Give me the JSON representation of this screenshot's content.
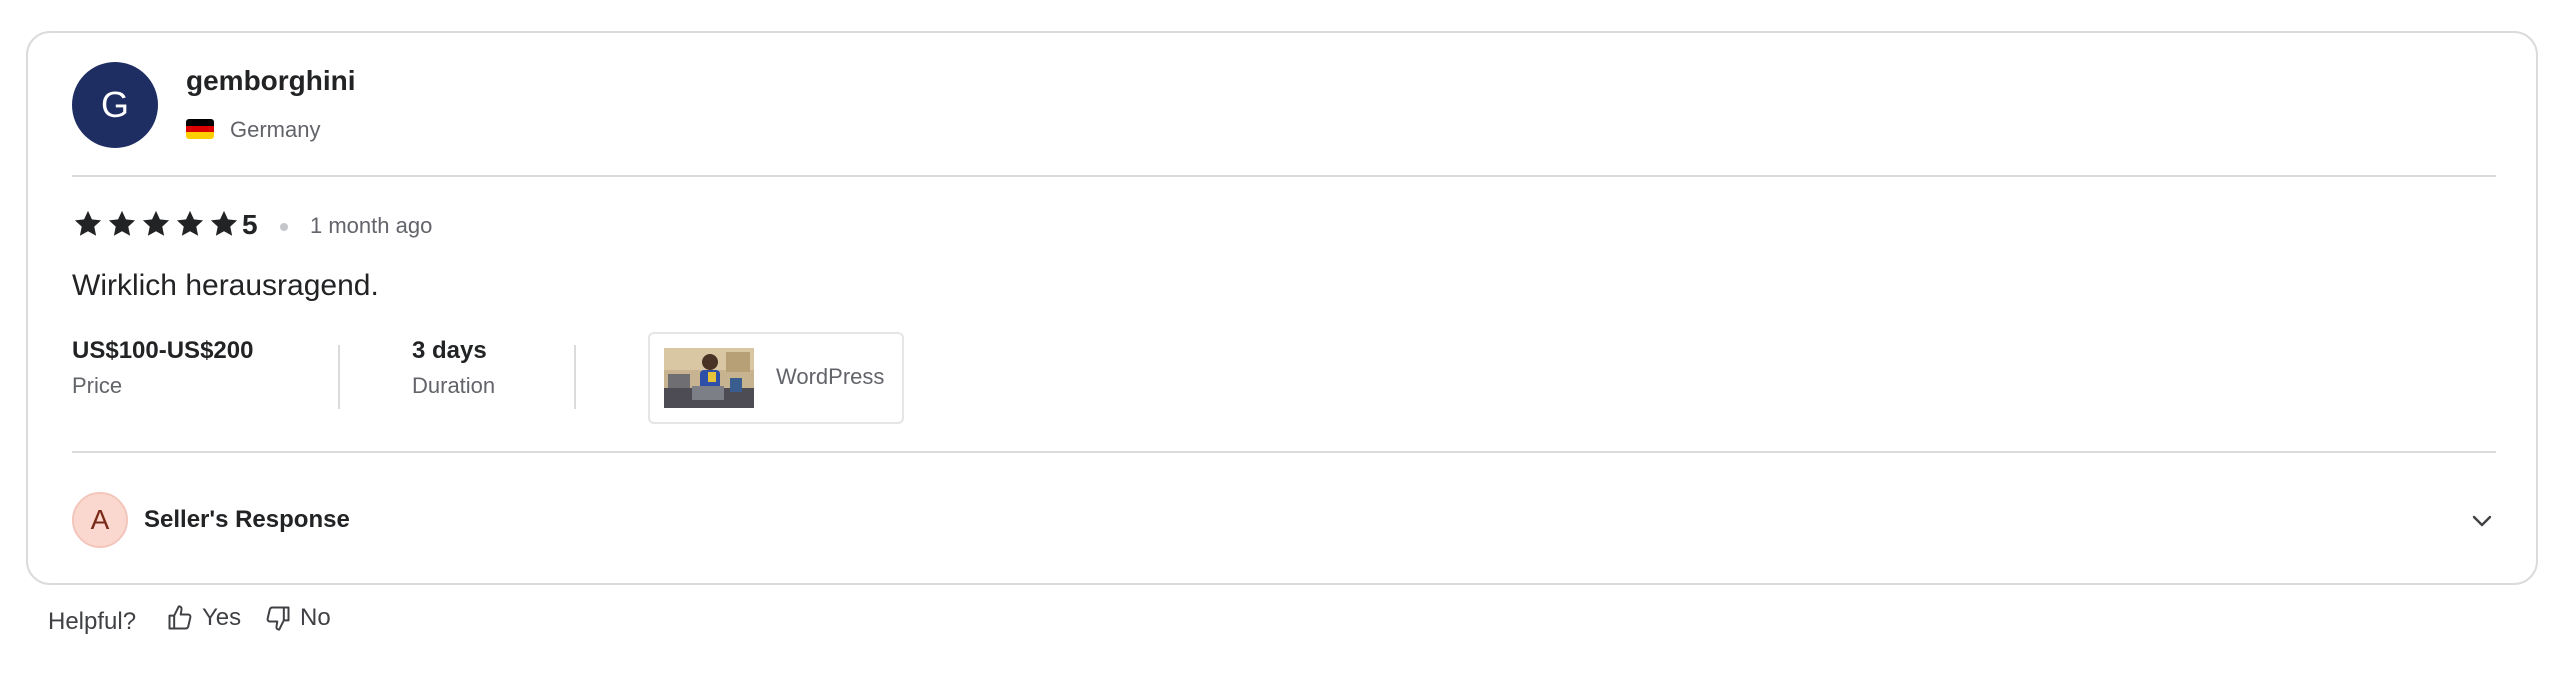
{
  "review": {
    "user": {
      "initial": "G",
      "username": "gemborghini",
      "country": "Germany",
      "avatar_color": "#1e2d62",
      "flag_colors": [
        "#000000",
        "#dd0000",
        "#ffce00"
      ]
    },
    "rating": {
      "stars": 5,
      "value": "5"
    },
    "time_ago": "1 month ago",
    "text": "Wirklich herausragend.",
    "stats": {
      "price_value": "US$100-US$200",
      "price_label": "Price",
      "duration_value": "3 days",
      "duration_label": "Duration"
    },
    "portfolio": {
      "label": "WordPress",
      "thumbnail_icon": "portfolio-thumbnail"
    },
    "seller_response": {
      "initial": "A",
      "title": "Seller's Response",
      "expand_icon": "chevron-down-icon"
    }
  },
  "helpful": {
    "question": "Helpful?",
    "yes_label": "Yes",
    "no_label": "No",
    "yes_icon": "thumbs-up-icon",
    "no_icon": "thumbs-down-icon"
  },
  "colors": {
    "star": "#222325",
    "border": "#dadbdd",
    "muted_text": "#62646a",
    "seller_avatar_bg": "#fbd8cf"
  }
}
